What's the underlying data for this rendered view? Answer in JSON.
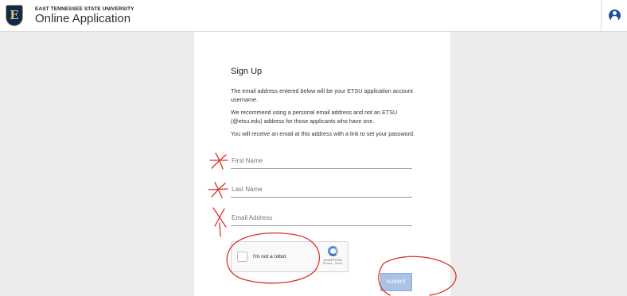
{
  "header": {
    "logo_letter": "E",
    "university": "EAST TENNESSEE STATE UNIVERSITY",
    "app_title": "Online Application"
  },
  "form": {
    "title": "Sign Up",
    "para1": "The email address entered below will be your ETSU application account username.",
    "para2": "We recommend using a personal email address and not an ETSU (@etsu.edu) address for those applicants who have one.",
    "para3": "You will receive an email at this address with a link to set your password.",
    "first_name_placeholder": "First Name",
    "last_name_placeholder": "Last Name",
    "email_placeholder": "Email Address",
    "captcha_label": "I'm not a robot",
    "captcha_brand": "reCAPTCHA",
    "captcha_links": "Privacy - Terms",
    "submit_label": "SUBMIT"
  },
  "colors": {
    "annotation": "#d9322b",
    "brand_navy": "#0b2a55",
    "submit_bg": "#a9c2e6"
  }
}
